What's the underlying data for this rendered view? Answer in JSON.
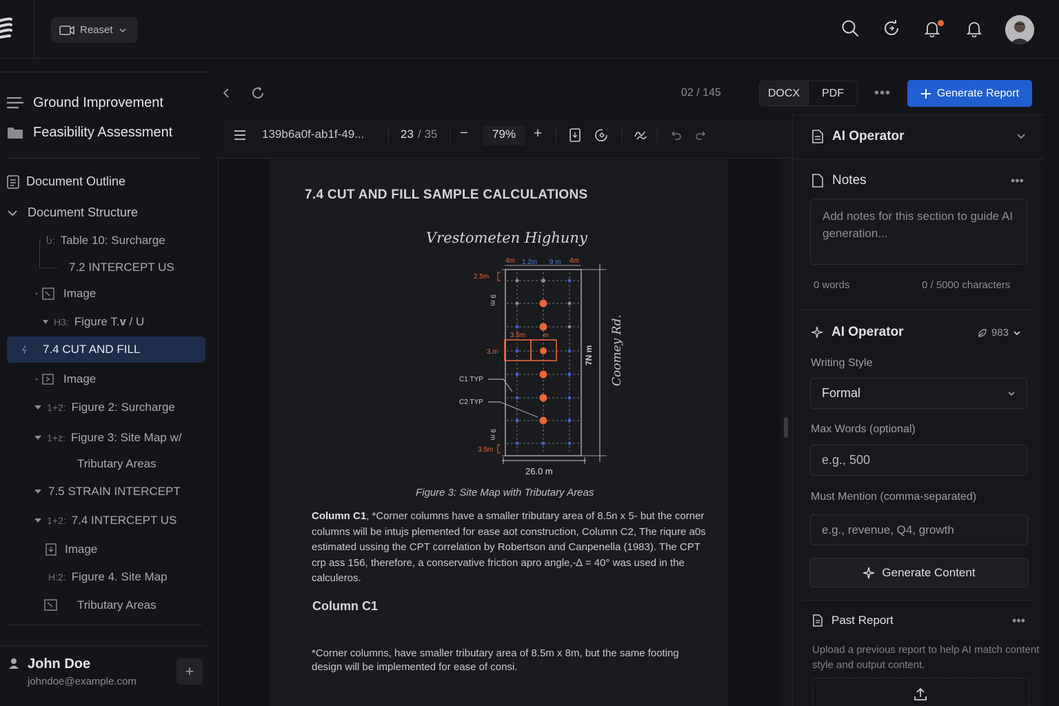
{
  "topbar": {
    "preset_label": "Reaset",
    "icons": [
      "search-icon",
      "refresh-icon",
      "notification-bell-icon",
      "bell-icon"
    ],
    "accent_dot": "#e8653e"
  },
  "sidebar": {
    "project": {
      "title": "Ground Improvement",
      "subtitle": "Feasibility Assessment"
    },
    "outline_label": "Document Outline",
    "structure_label": "Document Structure",
    "tree": [
      {
        "prefix": "Ⴑ:",
        "label": "Table 10: Surcharge"
      },
      {
        "prefix": "",
        "label": "7.2 INTERCEPT US"
      },
      {
        "prefix": "",
        "label": "Image"
      },
      {
        "prefix": "H3:",
        "label": "Figure T.𝐯 / U"
      },
      {
        "prefix": "",
        "label": "7.4 CUT AND FILL"
      },
      {
        "prefix": "",
        "label": "Image"
      },
      {
        "prefix": "1+2:",
        "label": "Figure 2: Surcharge"
      },
      {
        "prefix": "1+z:",
        "label": "Figure 3: Site Map w/"
      },
      {
        "prefix": "",
        "label": "Tributary Areas"
      },
      {
        "prefix": "",
        "label": "7.5 STRAIN INTERCEPT"
      },
      {
        "prefix": "1+2:",
        "label": "7.4 INTERCEPT US"
      },
      {
        "prefix": "",
        "label": "Image"
      },
      {
        "prefix": "H:2:",
        "label": "Figure 4. Site Map"
      },
      {
        "prefix": "",
        "label": "Tributary Areas"
      }
    ],
    "user": {
      "name": "John Doe",
      "email": "johndoe@example.com",
      "add_label": "+"
    }
  },
  "doc_toolbar": {
    "page_count": "02 / 145",
    "formats": [
      "DOCX",
      "PDF"
    ],
    "more": "•••",
    "generate_report": "Generate Report"
  },
  "viewer": {
    "file_name": "139b6a0f-ab1f-49...",
    "page_current": "23",
    "page_total": "/ 35",
    "zoom": "79%",
    "minus": "−",
    "plus": "+"
  },
  "document": {
    "heading": "7.4 CUT AND FILL SAMPLE CALCULATIONS",
    "sketch": {
      "title": "Vrestometen Highuny",
      "side_label": "Coomey Rd.",
      "dims_top": [
        "4m",
        "1.2m",
        "9 m",
        "4m"
      ],
      "left_labels": [
        "2.5m",
        "9 m",
        "3.5m",
        "3.m",
        "9 m",
        "3.5m"
      ],
      "inner_labels": [
        "3.5m",
        "m"
      ],
      "right_dim": "7N m",
      "bottom_dim": "26.0 m",
      "callouts": [
        "C1 TYP",
        "C2 TYP"
      ]
    },
    "figure_caption": "Figure 3: Site Map with Tributary Areas",
    "para1_bold": "Column C1",
    "para1_text": ", *Corner columns have a smaller tributary area of 8.5n x 5- but the corner columns will be intujs plemented for ease aot construction, Column C2, The riqure a0s estimated ussing the CPT correlation by Robertson and Canpenella (1983). The CPT crp ass 156, therefore, a conservative friction apro angle,-∆ = 40° was used in the calculeros.",
    "col_heading": "Column C1",
    "para2": "*Corner columns, have smaller tributary area of 8.5m x 8m, but the same footing design will be implemented for ease of consi."
  },
  "right_panel": {
    "ai_operator_title": "AI Operator",
    "notes": {
      "title": "Notes",
      "placeholder": "Add notes for this section to guide AI generation...",
      "words": "0 words",
      "chars": "0 / 5000 characters"
    },
    "ai_section": {
      "title": "AI Operator",
      "credits": "983",
      "writing_style_label": "Writing Style",
      "writing_style_value": "Formal",
      "max_words_label": "Max Words (optional)",
      "max_words_placeholder": "e.g., 500",
      "mention_label": "Must Mention (comma-separated)",
      "mention_placeholder": "e.g., revenue, Q4, growth",
      "generate_label": "Generate Content"
    },
    "past_report": {
      "title": "Past Report",
      "description": "Upload a previous report to help AI match content style and output content."
    }
  },
  "colors": {
    "accent": "#1f5fd1",
    "active_row": "#1d2d4a",
    "orange": "#e8653e",
    "blue_dot": "#3d64c9"
  }
}
